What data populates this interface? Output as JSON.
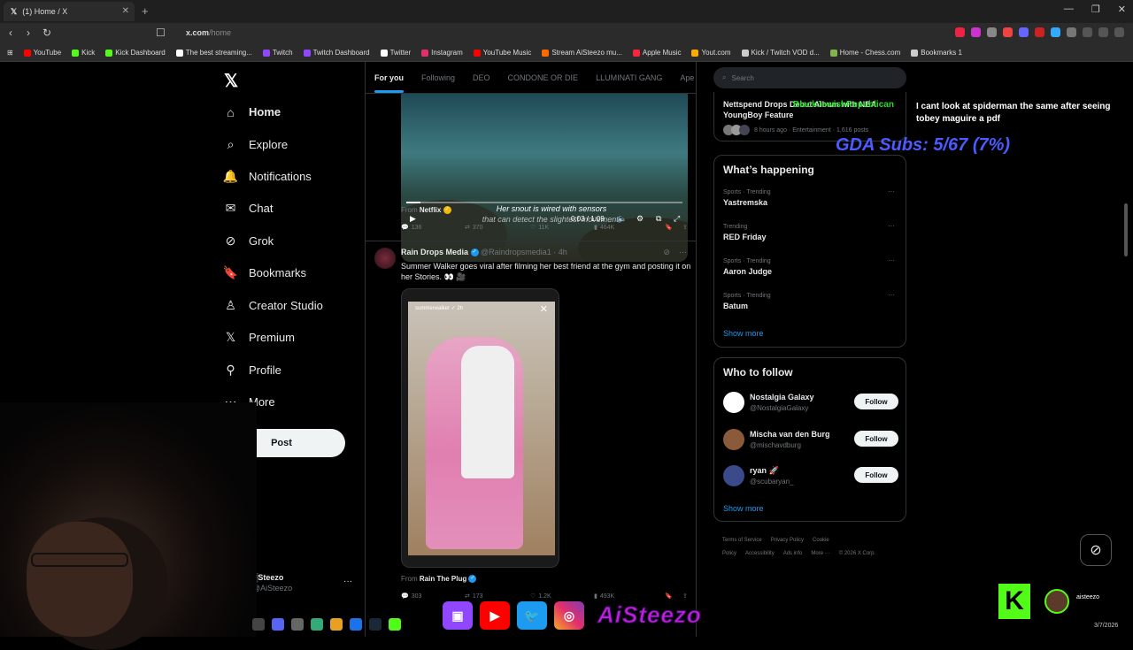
{
  "browser": {
    "tab_title": "(1) Home / X",
    "url_host": "x.com",
    "url_path": "/home",
    "bookmarks": [
      {
        "label": "YouTube",
        "color": "#ff0000"
      },
      {
        "label": "Kick",
        "color": "#53fc18"
      },
      {
        "label": "Kick Dashboard",
        "color": "#53fc18"
      },
      {
        "label": "The best streaming...",
        "color": "#ffffff"
      },
      {
        "label": "Twitch",
        "color": "#9146ff"
      },
      {
        "label": "Twitch Dashboard",
        "color": "#9146ff"
      },
      {
        "label": "Twitter",
        "color": "#ffffff"
      },
      {
        "label": "Instagram",
        "color": "#e1306c"
      },
      {
        "label": "YouTube Music",
        "color": "#ff0000"
      },
      {
        "label": "Stream AiSteezo mu...",
        "color": "#ff6a00"
      },
      {
        "label": "Apple Music",
        "color": "#fa243c"
      },
      {
        "label": "Yout.com",
        "color": "#ffaa00"
      },
      {
        "label": "Kick / Twitch VOD d...",
        "color": "#cccccc"
      },
      {
        "label": "Home - Chess.com",
        "color": "#81b64c"
      },
      {
        "label": "Bookmarks 1",
        "color": "#cccccc"
      }
    ]
  },
  "nav": {
    "items": [
      {
        "label": "Home",
        "icon": "home-icon",
        "glyph": "⌂"
      },
      {
        "label": "Explore",
        "icon": "search-icon",
        "glyph": "⌕"
      },
      {
        "label": "Notifications",
        "icon": "bell-icon",
        "glyph": "🔔"
      },
      {
        "label": "Chat",
        "icon": "mail-icon",
        "glyph": "✉"
      },
      {
        "label": "Grok",
        "icon": "grok-icon",
        "glyph": "⊘"
      },
      {
        "label": "Bookmarks",
        "icon": "bookmark-icon",
        "glyph": "🔖"
      },
      {
        "label": "Creator Studio",
        "icon": "flask-icon",
        "glyph": "♙"
      },
      {
        "label": "Premium",
        "icon": "x-icon",
        "glyph": "𝕏"
      },
      {
        "label": "Profile",
        "icon": "person-icon",
        "glyph": "⚲"
      },
      {
        "label": "More",
        "icon": "more-icon",
        "glyph": "⋯"
      }
    ],
    "post_label": "Post",
    "account_name": "▒Steezo",
    "account_handle": "@AiSteezo"
  },
  "timeline": {
    "tabs": [
      "For you",
      "Following",
      "DEO",
      "CONDONE OR DIE",
      "LLUMINATI GANG",
      "Ape"
    ],
    "tweet1": {
      "subtitle_line1": "Her snout is wired with sensors",
      "subtitle_line2": "that can detect the slightest movement.",
      "time": "0:03 / 1:09",
      "from_label": "From",
      "from_name": "Netflix",
      "replies": "136",
      "reposts": "370",
      "likes": "11K",
      "views": "464K"
    },
    "tweet2": {
      "name": "Rain Drops Media",
      "handle": "@Raindropsmedia1",
      "time": "· 4h",
      "text": "Summer Walker goes viral after filming her best friend at the gym and posting it on her Stories. 👀 🎥",
      "story_user": "summerwalker ✓ 2h",
      "from_label": "From",
      "from_name": "Rain The Plug",
      "replies": "303",
      "reposts": "173",
      "likes": "1.2K",
      "views": "493K"
    }
  },
  "sidebar": {
    "search_placeholder": "Search",
    "news_title": "Nettspend Drops Debut Album with NBA YoungBoy Feature",
    "news_meta": "8 hours ago · Entertainment · 1,616 posts",
    "whats_happening_title": "What’s happening",
    "trends": [
      {
        "context": "Sports · Trending",
        "name": "Yastremska"
      },
      {
        "context": "Trending",
        "name": "RED Friday"
      },
      {
        "context": "Sports · Trending",
        "name": "Aaron Judge"
      },
      {
        "context": "Sports · Trending",
        "name": "Batum"
      }
    ],
    "show_more": "Show more",
    "who_to_follow_title": "Who to follow",
    "follow_label": "Follow",
    "suggestions": [
      {
        "name": "Nostalgia Galaxy",
        "handle": "@NostalgiaGalaxy",
        "color": "#ffffff"
      },
      {
        "name": "Mischa van den Burg",
        "handle": "@mischavdburg",
        "color": "#8a5a3a"
      },
      {
        "name": "ryan 🚀",
        "handle": "@scubaryan_",
        "color": "#3a4a8a"
      }
    ],
    "footer": [
      "Terms of Service",
      "Privacy Policy",
      "Cookie Policy",
      "Accessibility",
      "Ads info",
      "More ···",
      "© 2026 X Corp."
    ]
  },
  "overlay": {
    "chat_user": "BlackJewishRepublican",
    "chat_text": "I cant look at spiderman the same after seeing tobey maguire a pdf",
    "sub_goal": "GDA Subs: 5/67 (7%)",
    "streamer_name": "AiSteezo",
    "kick_name": "aisteezo",
    "date": "3/7/2026"
  },
  "colors": {
    "accent": "#1d9bf0",
    "kick": "#53fc18",
    "subgoal": "#4a5cff"
  }
}
